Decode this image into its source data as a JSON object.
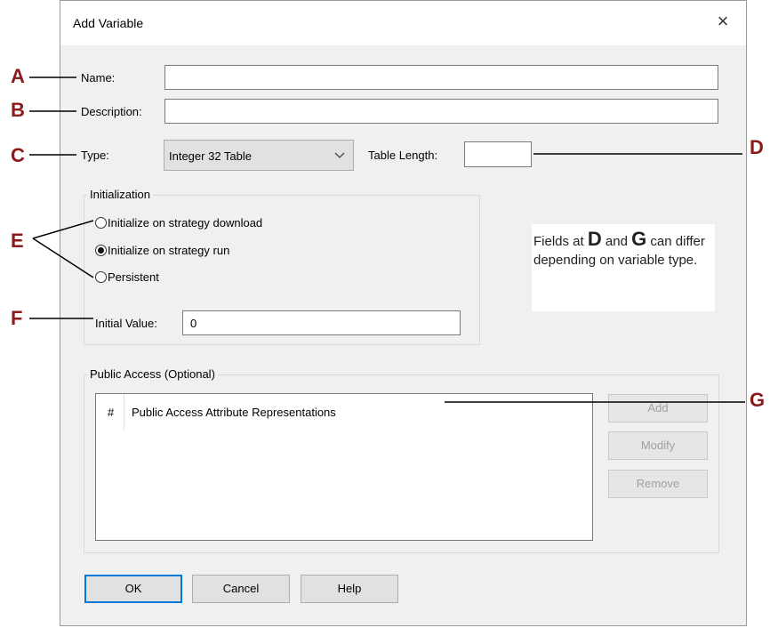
{
  "dialog": {
    "title": "Add Variable",
    "close_icon": "×"
  },
  "labels": {
    "name": "Name:",
    "description": "Description:",
    "type": "Type:",
    "table_length": "Table Length:",
    "initial_value": "Initial Value:"
  },
  "fields": {
    "name_value": "",
    "description_value": "",
    "type_selected": "Integer 32 Table",
    "table_length_value": "",
    "initial_value": "0"
  },
  "initialization": {
    "title": "Initialization",
    "options": [
      {
        "label": "Initialize on strategy download",
        "checked": false
      },
      {
        "label": "Initialize on strategy run",
        "checked": true
      },
      {
        "label": "Persistent",
        "checked": false
      }
    ]
  },
  "public_access": {
    "title": "Public Access (Optional)",
    "columns": [
      "#",
      "Public Access Attribute Representations"
    ],
    "buttons": {
      "add": "Add",
      "modify": "Modify",
      "remove": "Remove"
    }
  },
  "footer_buttons": {
    "ok": "OK",
    "cancel": "Cancel",
    "help": "Help"
  },
  "callouts": {
    "a": "A",
    "b": "B",
    "c": "C",
    "d": "D",
    "e": "E",
    "f": "F",
    "g": "G"
  },
  "note": {
    "prefix": "Fields at ",
    "d": "D",
    "and": " and ",
    "g": "G",
    "suffix": " can differ depending on variable type."
  },
  "colors": {
    "callout": "#8b1a1a",
    "default_button_border": "#0078d7",
    "dialog_bg": "#f0f0f0"
  }
}
